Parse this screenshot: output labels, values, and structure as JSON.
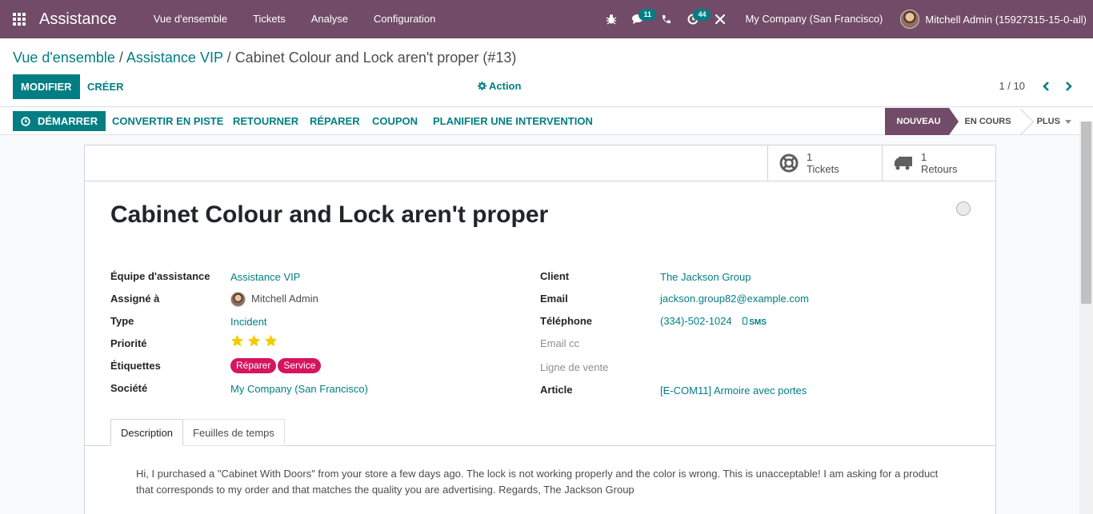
{
  "colors": {
    "brand": "#714b67",
    "accent": "#017e84",
    "tag": "#d6145f",
    "star": "#f3cc00"
  },
  "navbar": {
    "app_name": "Assistance",
    "menu": [
      "Vue d'ensemble",
      "Tickets",
      "Analyse",
      "Configuration"
    ],
    "messages_count": "11",
    "activities_count": "44",
    "company": "My Company (San Francisco)",
    "user": "Mitchell Admin (15927315-15-0-all)"
  },
  "breadcrumb": {
    "overview": "Vue d'ensemble",
    "team": "Assistance VIP",
    "current": "Cabinet Colour and Lock aren't proper (#13)",
    "separator": "/"
  },
  "controls": {
    "edit": "MODIFIER",
    "create": "CRÉER",
    "action": "Action",
    "pager": "1 / 10"
  },
  "header_buttons": [
    "DÉMARRER",
    "CONVERTIR EN PISTE",
    "RETOURNER",
    "RÉPARER",
    "COUPON",
    "PLANIFIER UNE INTERVENTION"
  ],
  "stages": {
    "new": "NOUVEAU",
    "in_progress": "EN COURS",
    "more": "PLUS"
  },
  "smart_buttons": {
    "tickets": {
      "count": "1",
      "label": "Tickets"
    },
    "returns": {
      "count": "1",
      "label": "Retours"
    }
  },
  "ticket": {
    "title": "Cabinet Colour and Lock aren't proper",
    "team_label": "Équipe d'assistance",
    "team": "Assistance VIP",
    "assigned_label": "Assigné à",
    "assigned": "Mitchell Admin",
    "type_label": "Type",
    "type": "Incident",
    "priority_label": "Priorité",
    "priority": 3,
    "tags_label": "Étiquettes",
    "tags": [
      "Réparer",
      "Service"
    ],
    "company_label": "Société",
    "company": "My Company (San Francisco)",
    "customer_label": "Client",
    "customer": "The Jackson Group",
    "email_label": "Email",
    "email": "jackson.group82@example.com",
    "phone_label": "Téléphone",
    "phone": "(334)-502-1024",
    "sms": "SMS",
    "email_cc_label": "Email cc",
    "sale_line_label": "Ligne de vente",
    "product_label": "Article",
    "product": "[E-COM11] Armoire avec portes"
  },
  "tabs": [
    "Description",
    "Feuilles de temps"
  ],
  "description": "Hi, I purchased a \"Cabinet With Doors\" from your store a few days ago. The lock is not working properly and the color is wrong. This is unacceptable! I am asking for a product that corresponds to my order and that matches the quality you are advertising. Regards, The Jackson Group"
}
